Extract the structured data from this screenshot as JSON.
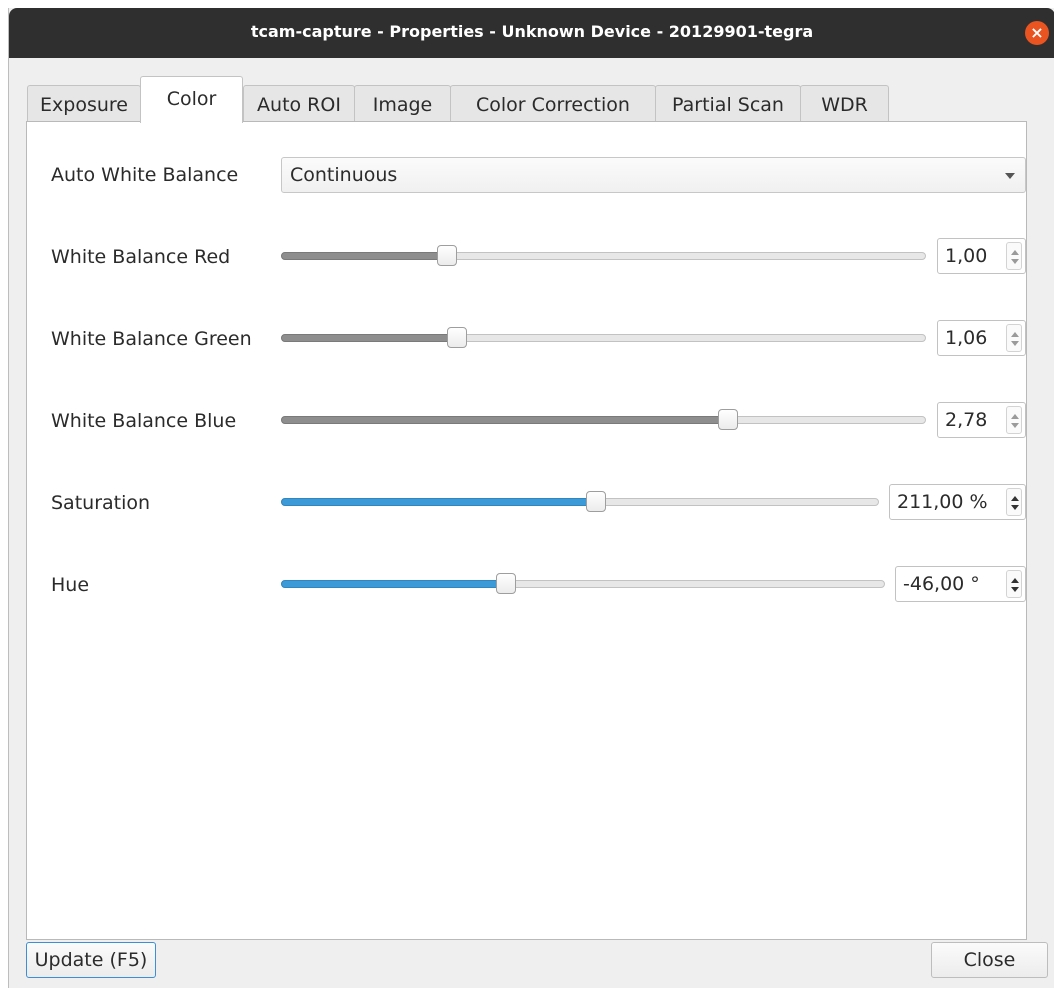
{
  "window": {
    "title": "tcam-capture - Properties - Unknown Device - 20129901-tegra",
    "close_glyph": "×"
  },
  "tabs": [
    {
      "label": "Exposure",
      "active": false
    },
    {
      "label": "Color",
      "active": true
    },
    {
      "label": "Auto ROI",
      "active": false
    },
    {
      "label": "Image",
      "active": false
    },
    {
      "label": "Color Correction",
      "active": false
    },
    {
      "label": "Partial Scan",
      "active": false
    },
    {
      "label": "WDR",
      "active": false
    }
  ],
  "color_tab": {
    "auto_white_balance": {
      "label": "Auto White Balance",
      "value": "Continuous"
    },
    "white_balance_red": {
      "label": "White Balance Red",
      "value": "1,00",
      "slider_fraction": 0.257
    },
    "white_balance_green": {
      "label": "White Balance Green",
      "value": "1,06",
      "slider_fraction": 0.273
    },
    "white_balance_blue": {
      "label": "White Balance Blue",
      "value": "2,78",
      "slider_fraction": 0.693
    },
    "saturation": {
      "label": "Saturation",
      "value": "211,00 %",
      "slider_fraction": 0.527
    },
    "hue": {
      "label": "Hue",
      "value": "-46,00 °",
      "slider_fraction": 0.373
    }
  },
  "footer": {
    "update_label": "Update (F5)",
    "close_label": "Close"
  },
  "colors": {
    "title_bar": "#2f2f2f",
    "close_circle": "#e95420",
    "slider_fill_blue": "#3c9ad6",
    "focus_border": "#3c8fd6"
  },
  "icons": {
    "window_close": "close-icon",
    "combo_arrow": "chevron-down-icon",
    "spin_up": "arrow-up-icon",
    "spin_down": "arrow-down-icon"
  }
}
